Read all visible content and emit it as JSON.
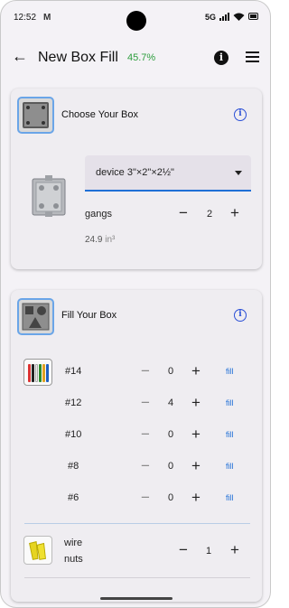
{
  "status_bar": {
    "time": "12:52",
    "mail_icon": "M",
    "network": "5G"
  },
  "app_bar": {
    "back_icon": "←",
    "title": "New Box Fill",
    "percent": "45.7%",
    "percent_color": "#2e9e3e",
    "info_icon": "i"
  },
  "choose_box": {
    "title": "Choose Your Box",
    "help_icon": "i",
    "selected_box": "device 3\"×2\"×2½\"",
    "gangs_label": "gangs",
    "gangs_value": "2",
    "minus": "−",
    "plus": "+",
    "volume": "24.9",
    "volume_unit": "in³"
  },
  "fill_box": {
    "title": "Fill Your Box",
    "help_icon": "i",
    "wires": [
      {
        "gauge": "#14",
        "count": "0",
        "fill": "fill"
      },
      {
        "gauge": "#12",
        "count": "4",
        "fill": "fill"
      },
      {
        "gauge": "#10",
        "count": "0",
        "fill": "fill"
      },
      {
        "gauge": "#8",
        "count": "0",
        "fill": "fill"
      },
      {
        "gauge": "#6",
        "count": "0",
        "fill": "fill"
      }
    ],
    "wire_nuts": {
      "label_line1": "wire",
      "label_line2": "nuts",
      "count": "1"
    },
    "minus": "−",
    "plus": "+"
  },
  "colors": {
    "accent": "#1f6fd6",
    "help": "#2a4fd6"
  }
}
